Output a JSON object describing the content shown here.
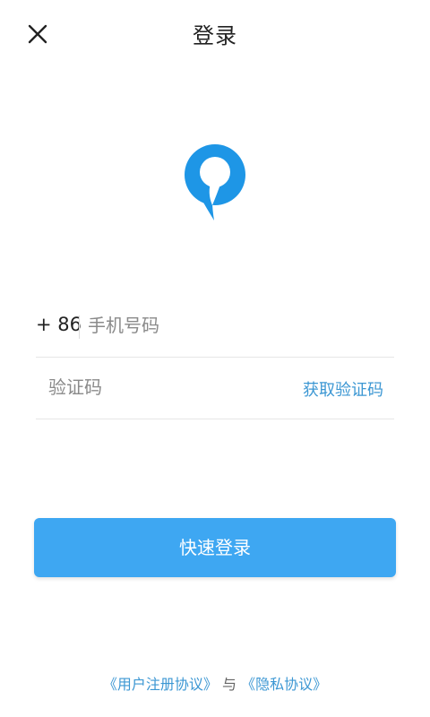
{
  "header": {
    "title": "登录",
    "close_icon": "close-icon"
  },
  "logo": {
    "icon": "speech-bubble-logo",
    "color": "#1e96e6"
  },
  "form": {
    "country_code": "+ 86",
    "phone_placeholder": "手机号码",
    "code_placeholder": "验证码",
    "get_code_label": "获取验证码"
  },
  "login_button": {
    "label": "快速登录",
    "color": "#3ea7f2"
  },
  "agreement": {
    "user_agreement": "《用户注册协议》",
    "conjunction": "与",
    "privacy_policy": "《隐私协议》"
  },
  "colors": {
    "accent": "#3c97d3",
    "divider": "#e6e6e6"
  }
}
